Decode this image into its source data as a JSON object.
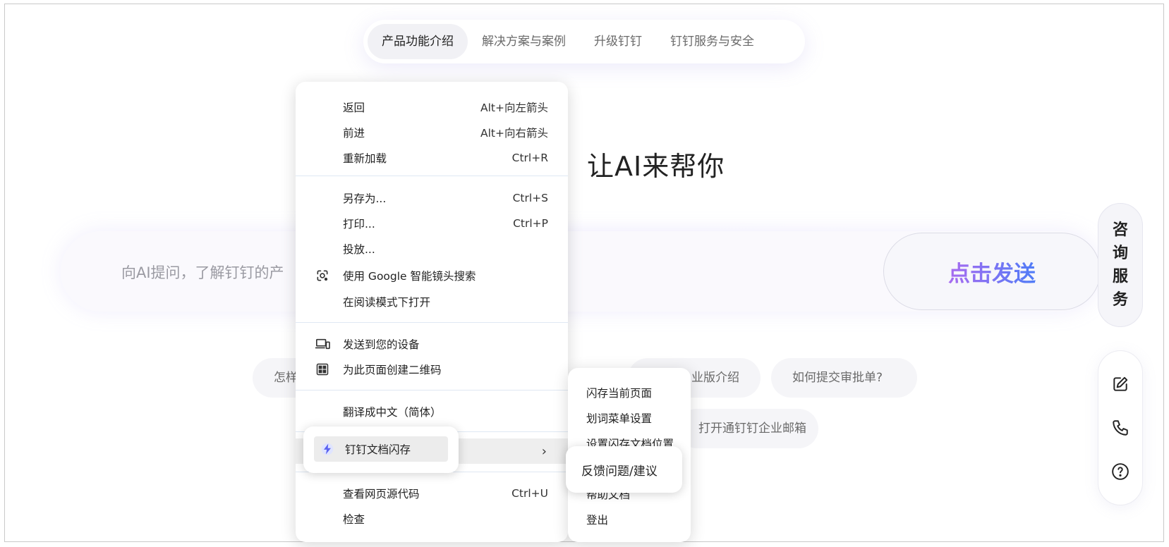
{
  "topnav": {
    "tabs": [
      {
        "label": "产品功能介绍",
        "active": true
      },
      {
        "label": "解决方案与案例",
        "active": false
      },
      {
        "label": "升级钉钉",
        "active": false
      },
      {
        "label": "钉钉服务与安全",
        "active": false
      }
    ]
  },
  "hero": {
    "title": "让AI来帮你"
  },
  "search": {
    "placeholder": "向AI提问，了解钉钉的产",
    "send_label": "点击发送"
  },
  "side": {
    "consult_chars": [
      "咨",
      "询",
      "服",
      "务"
    ],
    "tools": [
      "edit-icon",
      "phone-icon",
      "help-icon"
    ]
  },
  "chips": {
    "row1": [
      "怎样",
      "业版介绍",
      "如何提交审批单?"
    ],
    "row2": [
      "打开通钉钉企业邮箱"
    ]
  },
  "context_menu": {
    "back": {
      "label": "返回",
      "shortcut": "Alt+向左箭头"
    },
    "forward": {
      "label": "前进",
      "shortcut": "Alt+向右箭头"
    },
    "reload": {
      "label": "重新加载",
      "shortcut": "Ctrl+R"
    },
    "save_as": {
      "label": "另存为...",
      "shortcut": "Ctrl+S"
    },
    "print": {
      "label": "打印...",
      "shortcut": "Ctrl+P"
    },
    "cast": {
      "label": "投放..."
    },
    "google_lens": {
      "label": "使用 Google 智能镜头搜索"
    },
    "reader_mode": {
      "label": "在阅读模式下打开"
    },
    "send_to_devices": {
      "label": "发送到您的设备"
    },
    "qr_code": {
      "label": "为此页面创建二维码"
    },
    "translate": {
      "label": "翻译成中文（简体）"
    },
    "dingtalk_flash": {
      "label": "钉钉文档闪存",
      "arrow": "›"
    },
    "view_source": {
      "label": "查看网页源代码",
      "shortcut": "Ctrl+U"
    },
    "inspect": {
      "label": "检查"
    }
  },
  "submenu": {
    "items": [
      "闪存当前页面",
      "划词菜单设置",
      "设置闪存文档位置",
      "帮助文档",
      "登出"
    ],
    "callout": "反馈问题/建议"
  }
}
